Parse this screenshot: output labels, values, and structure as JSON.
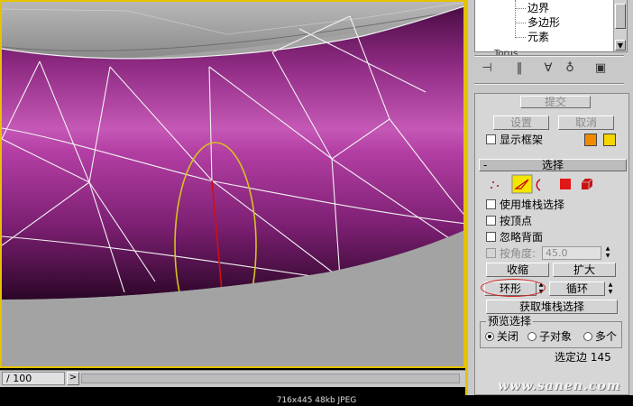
{
  "tree": {
    "items": [
      "边界",
      "多边形",
      "元素"
    ],
    "root_label": "Torus"
  },
  "toolbar_icons": [
    "pin-stack-icon",
    "show-end-result-icon",
    "make-unique-icon",
    "remove-modifier-icon",
    "configure-modifier-sets-icon"
  ],
  "edit": {
    "commit_label": "提交",
    "settings_label": "设置",
    "cancel_label": "取消",
    "show_cage_label": "显示框架",
    "cage_colors": [
      "#f08a00",
      "#f5d400"
    ]
  },
  "selection": {
    "rollout_title": "选择",
    "rollout_toggle": "-",
    "levels": [
      "vertex",
      "edge",
      "border",
      "polygon",
      "element"
    ],
    "active_level": "edge",
    "by_stack_label": "使用堆栈选择",
    "by_vertex_label": "按顶点",
    "ignore_backfacing_label": "忽略背面",
    "by_angle_label": "按角度:",
    "by_angle_value": "45.0",
    "shrink_label": "收缩",
    "grow_label": "扩大",
    "ring_label": "环形",
    "loop_label": "循环",
    "get_stack_selection_label": "获取堆栈选择",
    "preview_title": "预览选择",
    "preview_options": [
      "关闭",
      "子对象",
      "多个"
    ],
    "preview_selected": 0,
    "status": "选定边 145"
  },
  "timeline": {
    "frame": "/ 100",
    "next_label": ">"
  },
  "caption": "716x445  48kb  JPEG",
  "watermark": "www.sanen.com",
  "colors": {
    "viewport_border": "#e6c200",
    "mesh": "#b0339c",
    "ring_highlight": "#d8c21a",
    "selected_edge": "#d01010"
  }
}
